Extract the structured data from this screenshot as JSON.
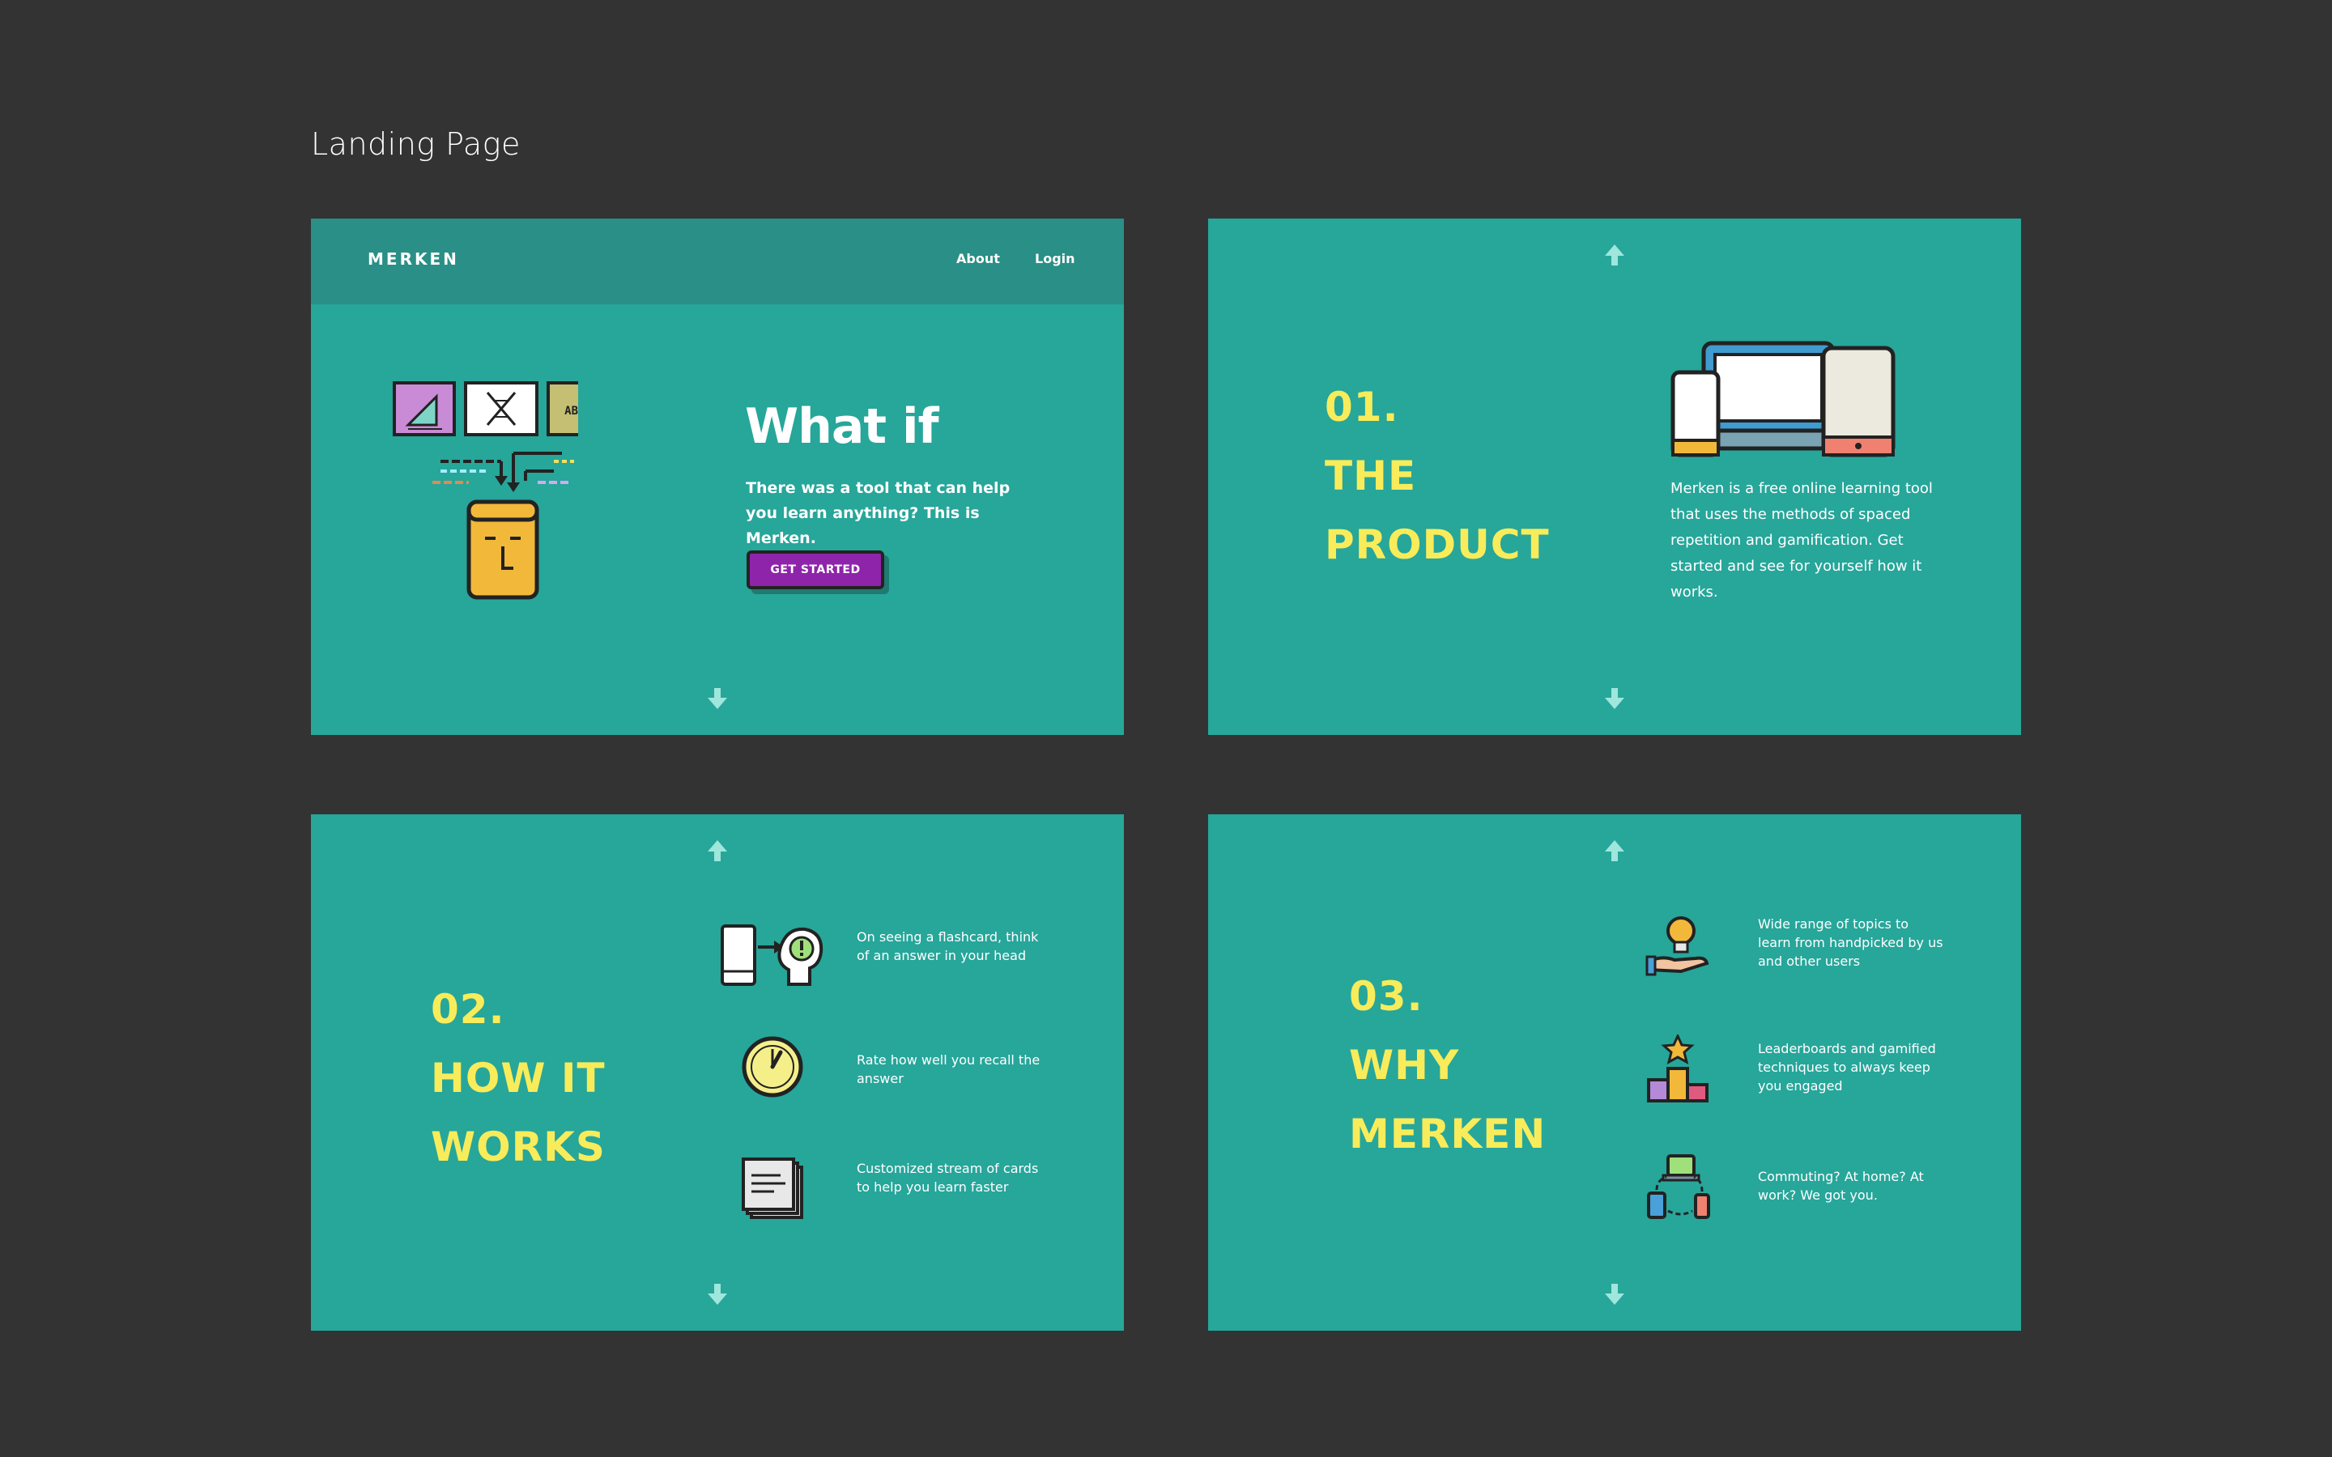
{
  "page": {
    "heading": "Landing Page"
  },
  "hero": {
    "brand": "MERKEN",
    "nav": {
      "about": "About",
      "login": "Login"
    },
    "title": "What if",
    "subtitle": "There was a tool that can help you learn anything? This is Merken.",
    "cta": "GET STARTED",
    "card_labels": {
      "abcd": "ABCD"
    }
  },
  "product": {
    "number": "01.",
    "title_line1": "THE",
    "title_line2": "PRODUCT",
    "text": "Merken is a free online learning tool that uses the methods of spaced repetition and gamification. Get started and see for yourself how it works."
  },
  "how": {
    "number": "02.",
    "title_line1": "HOW IT",
    "title_line2": "WORKS",
    "steps": [
      {
        "icon": "flashcard-think-icon",
        "text": "On seeing a flashcard, think of an answer in your head"
      },
      {
        "icon": "gauge-icon",
        "text": "Rate how well you recall the answer"
      },
      {
        "icon": "card-stack-icon",
        "text": "Customized stream of cards to help you learn faster"
      }
    ]
  },
  "why": {
    "number": "03.",
    "title_line1": "WHY",
    "title_line2": "MERKEN",
    "reasons": [
      {
        "icon": "lightbulb-hand-icon",
        "text": "Wide range of topics to learn from handpicked by us and other users"
      },
      {
        "icon": "podium-icon",
        "text": "Leaderboards and gamified techniques to always keep you engaged"
      },
      {
        "icon": "devices-sync-icon",
        "text": "Commuting? At home? At work? We got you."
      }
    ]
  },
  "colors": {
    "background": "#333333",
    "panel": "#27a69a",
    "navbar": "#2a8f86",
    "accent_yellow": "#f8ec5a",
    "cta_purple": "#8e24aa"
  }
}
